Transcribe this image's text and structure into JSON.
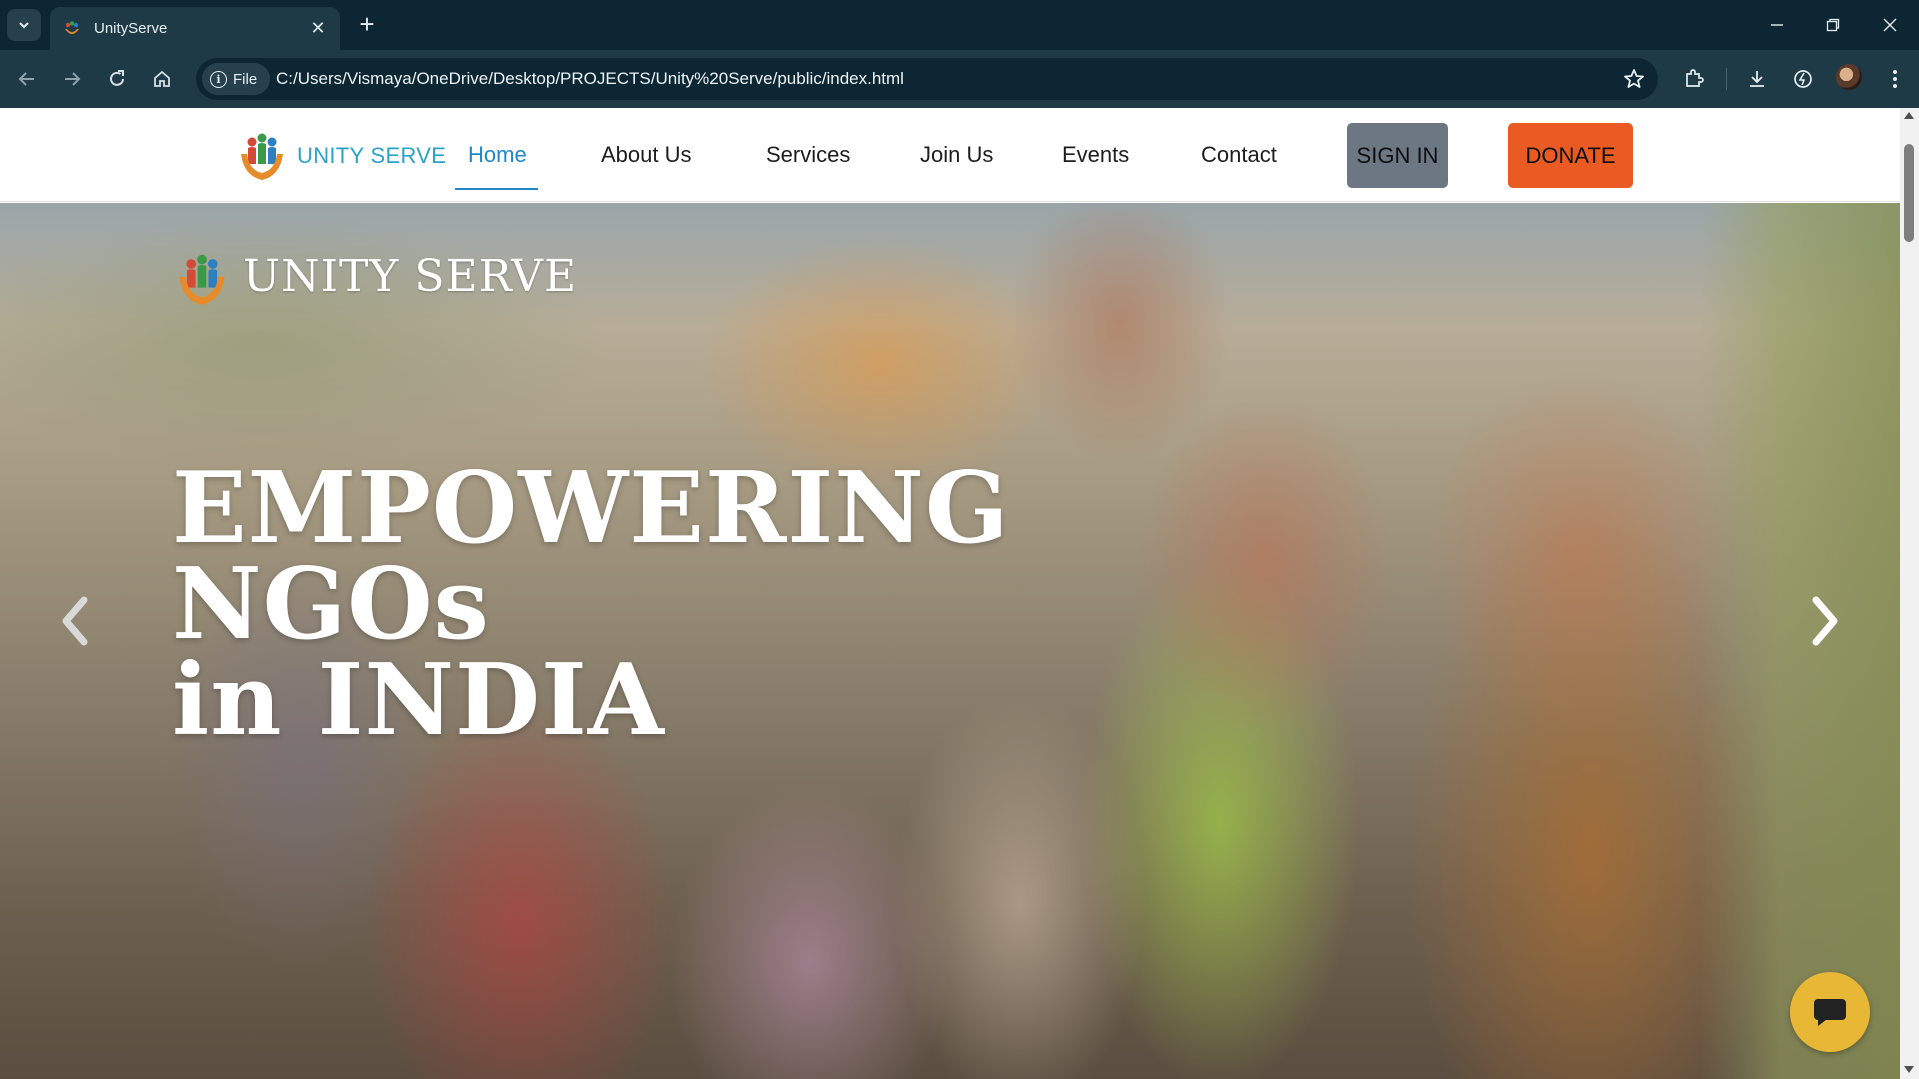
{
  "browser": {
    "tab": {
      "title": "UnityServe",
      "close_glyph": "✕"
    },
    "new_tab_glyph": "+",
    "address": {
      "chip_label": "File",
      "url": "C:/Users/Vismaya/OneDrive/Desktop/PROJECTS/Unity%20Serve/public/index.html"
    }
  },
  "site": {
    "logo_text": "UNITY SERVE",
    "nav": [
      {
        "label": "Home",
        "active": true
      },
      {
        "label": "About Us"
      },
      {
        "label": "Services"
      },
      {
        "label": "Join Us"
      },
      {
        "label": "Events"
      },
      {
        "label": "Contact"
      }
    ],
    "signin_label": "SIGN IN",
    "donate_label": "DONATE",
    "colors": {
      "brand_blue": "#2aa3c8",
      "active_link": "#1e88c8",
      "signin_bg": "#6d7784",
      "donate_bg": "#ea5b24",
      "chat_bg": "#e7b735"
    }
  },
  "hero": {
    "logo_text": "UNITY SERVE",
    "title_lines": [
      "EMPOWERING",
      "NGOs",
      "in INDIA"
    ],
    "prev_icon": "chevron-left-icon",
    "next_icon": "chevron-right-icon",
    "chat_icon": "chat-bubble-icon"
  }
}
